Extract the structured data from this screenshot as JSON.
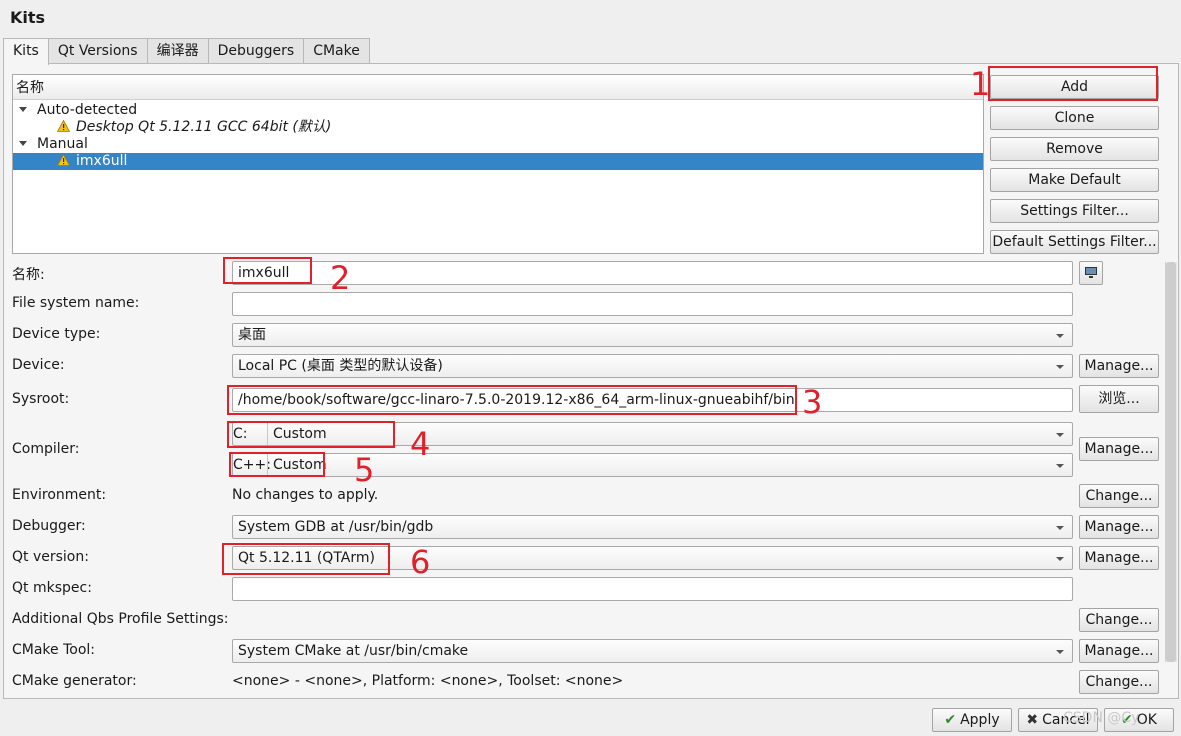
{
  "window": {
    "title": "Kits"
  },
  "tabs": [
    "Kits",
    "Qt Versions",
    "编译器",
    "Debuggers",
    "CMake"
  ],
  "tree": {
    "header": "名称",
    "groups": [
      {
        "label": "Auto-detected",
        "items": [
          "Desktop Qt 5.12.11 GCC 64bit (默认)"
        ]
      },
      {
        "label": "Manual",
        "items": [
          "imx6ull"
        ]
      }
    ]
  },
  "side_buttons": {
    "add": "Add",
    "clone": "Clone",
    "remove": "Remove",
    "make_default": "Make Default",
    "settings_filter": "Settings Filter...",
    "default_settings_filter": "Default Settings Filter..."
  },
  "form": {
    "name": {
      "label": "名称:",
      "value": "imx6ull"
    },
    "fs_name": {
      "label": "File system name:",
      "value": ""
    },
    "device_type": {
      "label": "Device type:",
      "value": "桌面"
    },
    "device": {
      "label": "Device:",
      "value": "Local PC (桌面 类型的默认设备)",
      "button": "Manage..."
    },
    "sysroot": {
      "label": "Sysroot:",
      "value": "/home/book/software/gcc-linaro-7.5.0-2019.12-x86_64_arm-linux-gnueabihf/bin",
      "button": "浏览..."
    },
    "compiler": {
      "label": "Compiler:",
      "c_label": "C:",
      "c_value": "Custom",
      "cpp_label": "C++:",
      "cpp_value": "Custom",
      "button": "Manage..."
    },
    "environment": {
      "label": "Environment:",
      "value": "No changes to apply.",
      "button": "Change..."
    },
    "debugger": {
      "label": "Debugger:",
      "value": "System GDB at /usr/bin/gdb",
      "button": "Manage..."
    },
    "qt_version": {
      "label": "Qt version:",
      "value": "Qt 5.12.11 (QTArm)",
      "button": "Manage..."
    },
    "qt_mkspec": {
      "label": "Qt mkspec:",
      "value": ""
    },
    "qbs": {
      "label": "Additional Qbs Profile Settings:",
      "button": "Change..."
    },
    "cmake_tool": {
      "label": "CMake Tool:",
      "value": "System CMake at /usr/bin/cmake",
      "button": "Manage..."
    },
    "cmake_generator": {
      "label": "CMake generator:",
      "value": "<none> - <none>, Platform: <none>, Toolset: <none>",
      "button": "Change..."
    }
  },
  "annotations": [
    "1",
    "2",
    "3",
    "4",
    "5",
    "6"
  ],
  "dialog_buttons": {
    "apply": "Apply",
    "cancel": "Cancel",
    "ok": "OK"
  },
  "watermark": "CSDN @Cy"
}
